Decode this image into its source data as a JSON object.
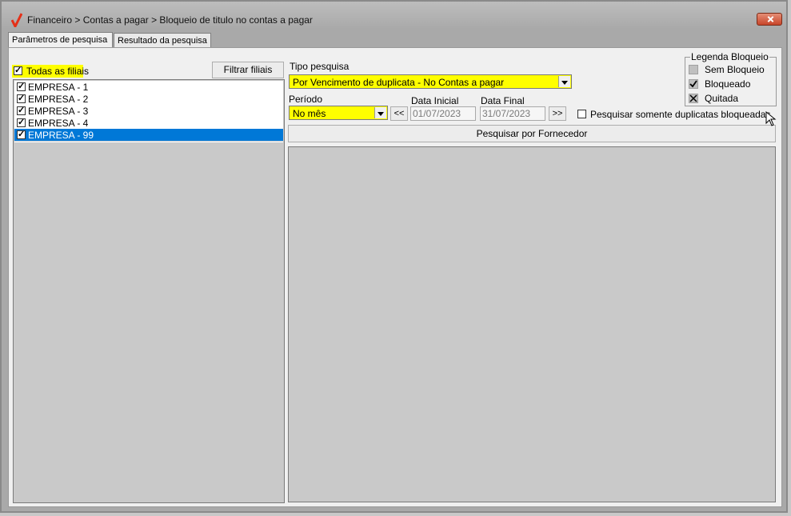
{
  "window": {
    "title": "Financeiro > Contas a pagar > Bloqueio de titulo no contas a pagar"
  },
  "tabs": [
    {
      "label": "Parâmetros de pesquisa",
      "active": true
    },
    {
      "label": "Resultado da pesquisa",
      "active": false
    }
  ],
  "filiais": {
    "all_label": "Todas as filiais",
    "all_checked": true,
    "filter_button": "Filtrar filiais",
    "items": [
      {
        "label": "EMPRESA - 1",
        "checked": true
      },
      {
        "label": "EMPRESA - 2",
        "checked": true
      },
      {
        "label": "EMPRESA - 3",
        "checked": true
      },
      {
        "label": "EMPRESA - 4",
        "checked": true
      },
      {
        "label": "EMPRESA - 99",
        "checked": true,
        "selected": true
      }
    ]
  },
  "tipo_pesquisa": {
    "label": "Tipo pesquisa",
    "value": "Por Vencimento de duplicata - No Contas a pagar"
  },
  "periodo": {
    "label": "Período",
    "value": "No mês",
    "prev_button": "<<",
    "next_button": ">>"
  },
  "data_inicial": {
    "label": "Data Inicial",
    "value": "01/07/2023"
  },
  "data_final": {
    "label": "Data Final",
    "value": "31/07/2023"
  },
  "somente_bloqueadas": {
    "label": "Pesquisar somente duplicatas bloqueadas",
    "checked": false
  },
  "fornecedor_button": "Pesquisar por Fornecedor",
  "legenda": {
    "title": "Legenda Bloqueio",
    "items": [
      {
        "label": "Sem Bloqueio",
        "icon": "gray-square-icon"
      },
      {
        "label": "Bloqueado",
        "icon": "check-icon"
      },
      {
        "label": "Quitada",
        "icon": "x-icon"
      }
    ]
  },
  "colors": {
    "highlight": "#ffff00",
    "selection": "#0078d7"
  }
}
